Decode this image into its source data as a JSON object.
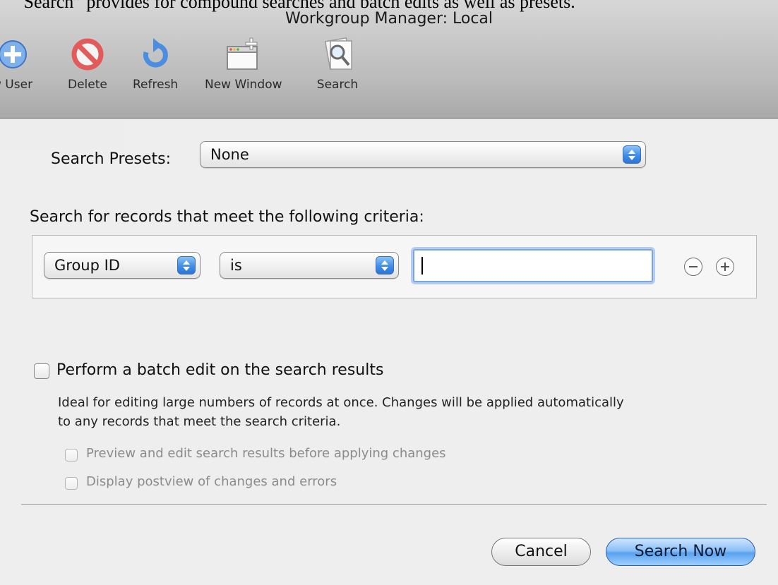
{
  "caption": "“Search” provides for compound searches and batch edits as well as presets.",
  "window": {
    "title": "Workgroup Manager: Local"
  },
  "toolbar": {
    "items": [
      {
        "label": "w User",
        "icon": "new-user-icon"
      },
      {
        "label": "Delete",
        "icon": "delete-icon"
      },
      {
        "label": "Refresh",
        "icon": "refresh-icon"
      },
      {
        "label": "New Window",
        "icon": "new-window-icon"
      },
      {
        "label": "Search",
        "icon": "search-icon"
      }
    ]
  },
  "search_presets": {
    "label": "Search Presets:",
    "selected": "None"
  },
  "criteria": {
    "heading": "Search for records that meet the following criteria:",
    "rows": [
      {
        "field": "Group ID",
        "operator": "is",
        "value": ""
      }
    ]
  },
  "batch_edit": {
    "checkbox_label": "Perform a batch edit on the search results",
    "checked": false,
    "description_line1": "Ideal for editing large numbers of records at once.  Changes will be applied automatically",
    "description_line2": "to any records that meet the search criteria.",
    "options": [
      {
        "label": "Preview and edit search results before applying changes",
        "checked": false,
        "enabled": false
      },
      {
        "label": "Display postview of changes and errors",
        "checked": false,
        "enabled": false
      }
    ]
  },
  "buttons": {
    "cancel": "Cancel",
    "search_now": "Search Now"
  },
  "colors": {
    "accent": "#5aa2ee",
    "focus_ring": "#7aa7e0"
  }
}
